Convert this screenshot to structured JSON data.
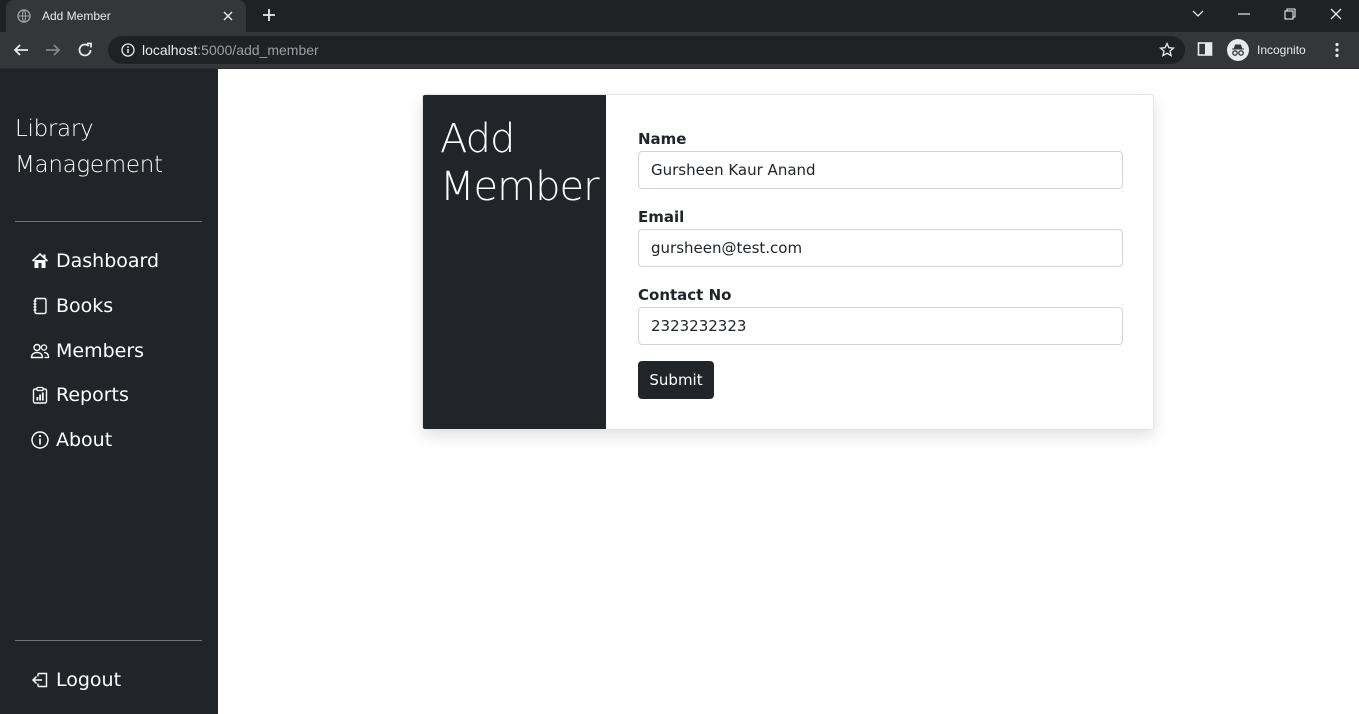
{
  "browser": {
    "tab_title": "Add Member",
    "url_host": "localhost",
    "url_path": ":5000/add_member",
    "profile_label": "Incognito"
  },
  "sidebar": {
    "brand_line1": "Library",
    "brand_line2": "Management",
    "items": [
      {
        "label": "Dashboard",
        "icon": "house-icon"
      },
      {
        "label": "Books",
        "icon": "book-icon"
      },
      {
        "label": "Members",
        "icon": "people-icon"
      },
      {
        "label": "Reports",
        "icon": "clipboard-chart-icon"
      },
      {
        "label": "About",
        "icon": "info-icon"
      }
    ],
    "logout_label": "Logout"
  },
  "form": {
    "heading_line1": "Add",
    "heading_line2": "Member",
    "name_label": "Name",
    "name_value": "Gursheen Kaur Anand",
    "email_label": "Email",
    "email_value": "gursheen@test.com",
    "contact_label": "Contact No",
    "contact_value": "2323232323",
    "submit_label": "Submit"
  },
  "colors": {
    "sidebar_bg": "#212529",
    "chrome_bg": "#202124",
    "toolbar_bg": "#35363a"
  }
}
